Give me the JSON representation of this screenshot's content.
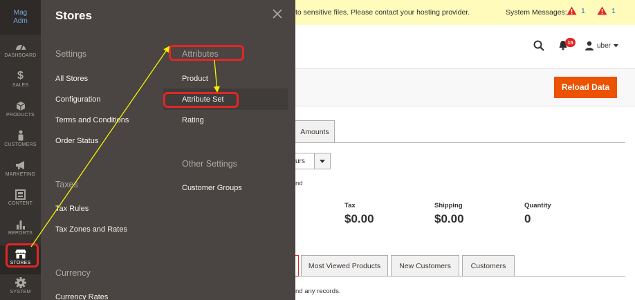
{
  "sidebar": {
    "logo_lines": [
      "Mag",
      "Adm"
    ],
    "items": [
      {
        "label": "DASHBOARD",
        "icon": "dashboard-icon"
      },
      {
        "label": "SALES",
        "icon": "dollar-icon"
      },
      {
        "label": "PRODUCTS",
        "icon": "box-icon"
      },
      {
        "label": "CUSTOMERS",
        "icon": "person-icon"
      },
      {
        "label": "MARKETING",
        "icon": "megaphone-icon"
      },
      {
        "label": "CONTENT",
        "icon": "content-icon"
      },
      {
        "label": "REPORTS",
        "icon": "bar-chart-icon"
      },
      {
        "label": "STORES",
        "icon": "store-icon"
      },
      {
        "label": "SYSTEM",
        "icon": "gear-icon"
      }
    ]
  },
  "flyout": {
    "title": "Stores",
    "settings": {
      "heading": "Settings",
      "links": [
        "All Stores",
        "Configuration",
        "Terms and Conditions",
        "Order Status"
      ]
    },
    "taxes": {
      "heading": "Taxes",
      "links": [
        "Tax Rules",
        "Tax Zones and Rates"
      ]
    },
    "currency": {
      "heading": "Currency",
      "links": [
        "Currency Rates"
      ]
    },
    "attributes": {
      "heading": "Attributes",
      "links": [
        "Product",
        "Attribute Set",
        "Rating"
      ]
    },
    "other_settings": {
      "heading": "Other Settings",
      "links": [
        "Customer Groups"
      ]
    }
  },
  "message_bar": {
    "text": "to sensitive files. Please contact your hosting provider.",
    "system_messages_label": "System Messages:",
    "critical_count": "1",
    "major_count": "1"
  },
  "header": {
    "notification_count": "15",
    "username": "uber"
  },
  "actions": {
    "reload_label": "Reload Data"
  },
  "dashboard": {
    "amounts_tab": "Amounts",
    "period_value": "urs",
    "partial_text_1": "nd",
    "stats": [
      {
        "label": "Tax",
        "value": "$0.00"
      },
      {
        "label": "Shipping",
        "value": "$0.00"
      },
      {
        "label": "Quantity",
        "value": "0"
      }
    ],
    "grid_tabs": [
      "Most Viewed Products",
      "New Customers",
      "Customers"
    ],
    "partial_text_2": "nd any records."
  },
  "colors": {
    "sidebar_bg": "#373330",
    "flyout_bg": "#4a4542",
    "highlight_red": "#e22626",
    "arrow_yellow": "#f5f500",
    "reload_orange": "#eb5202",
    "message_bg": "#fffbbb"
  }
}
